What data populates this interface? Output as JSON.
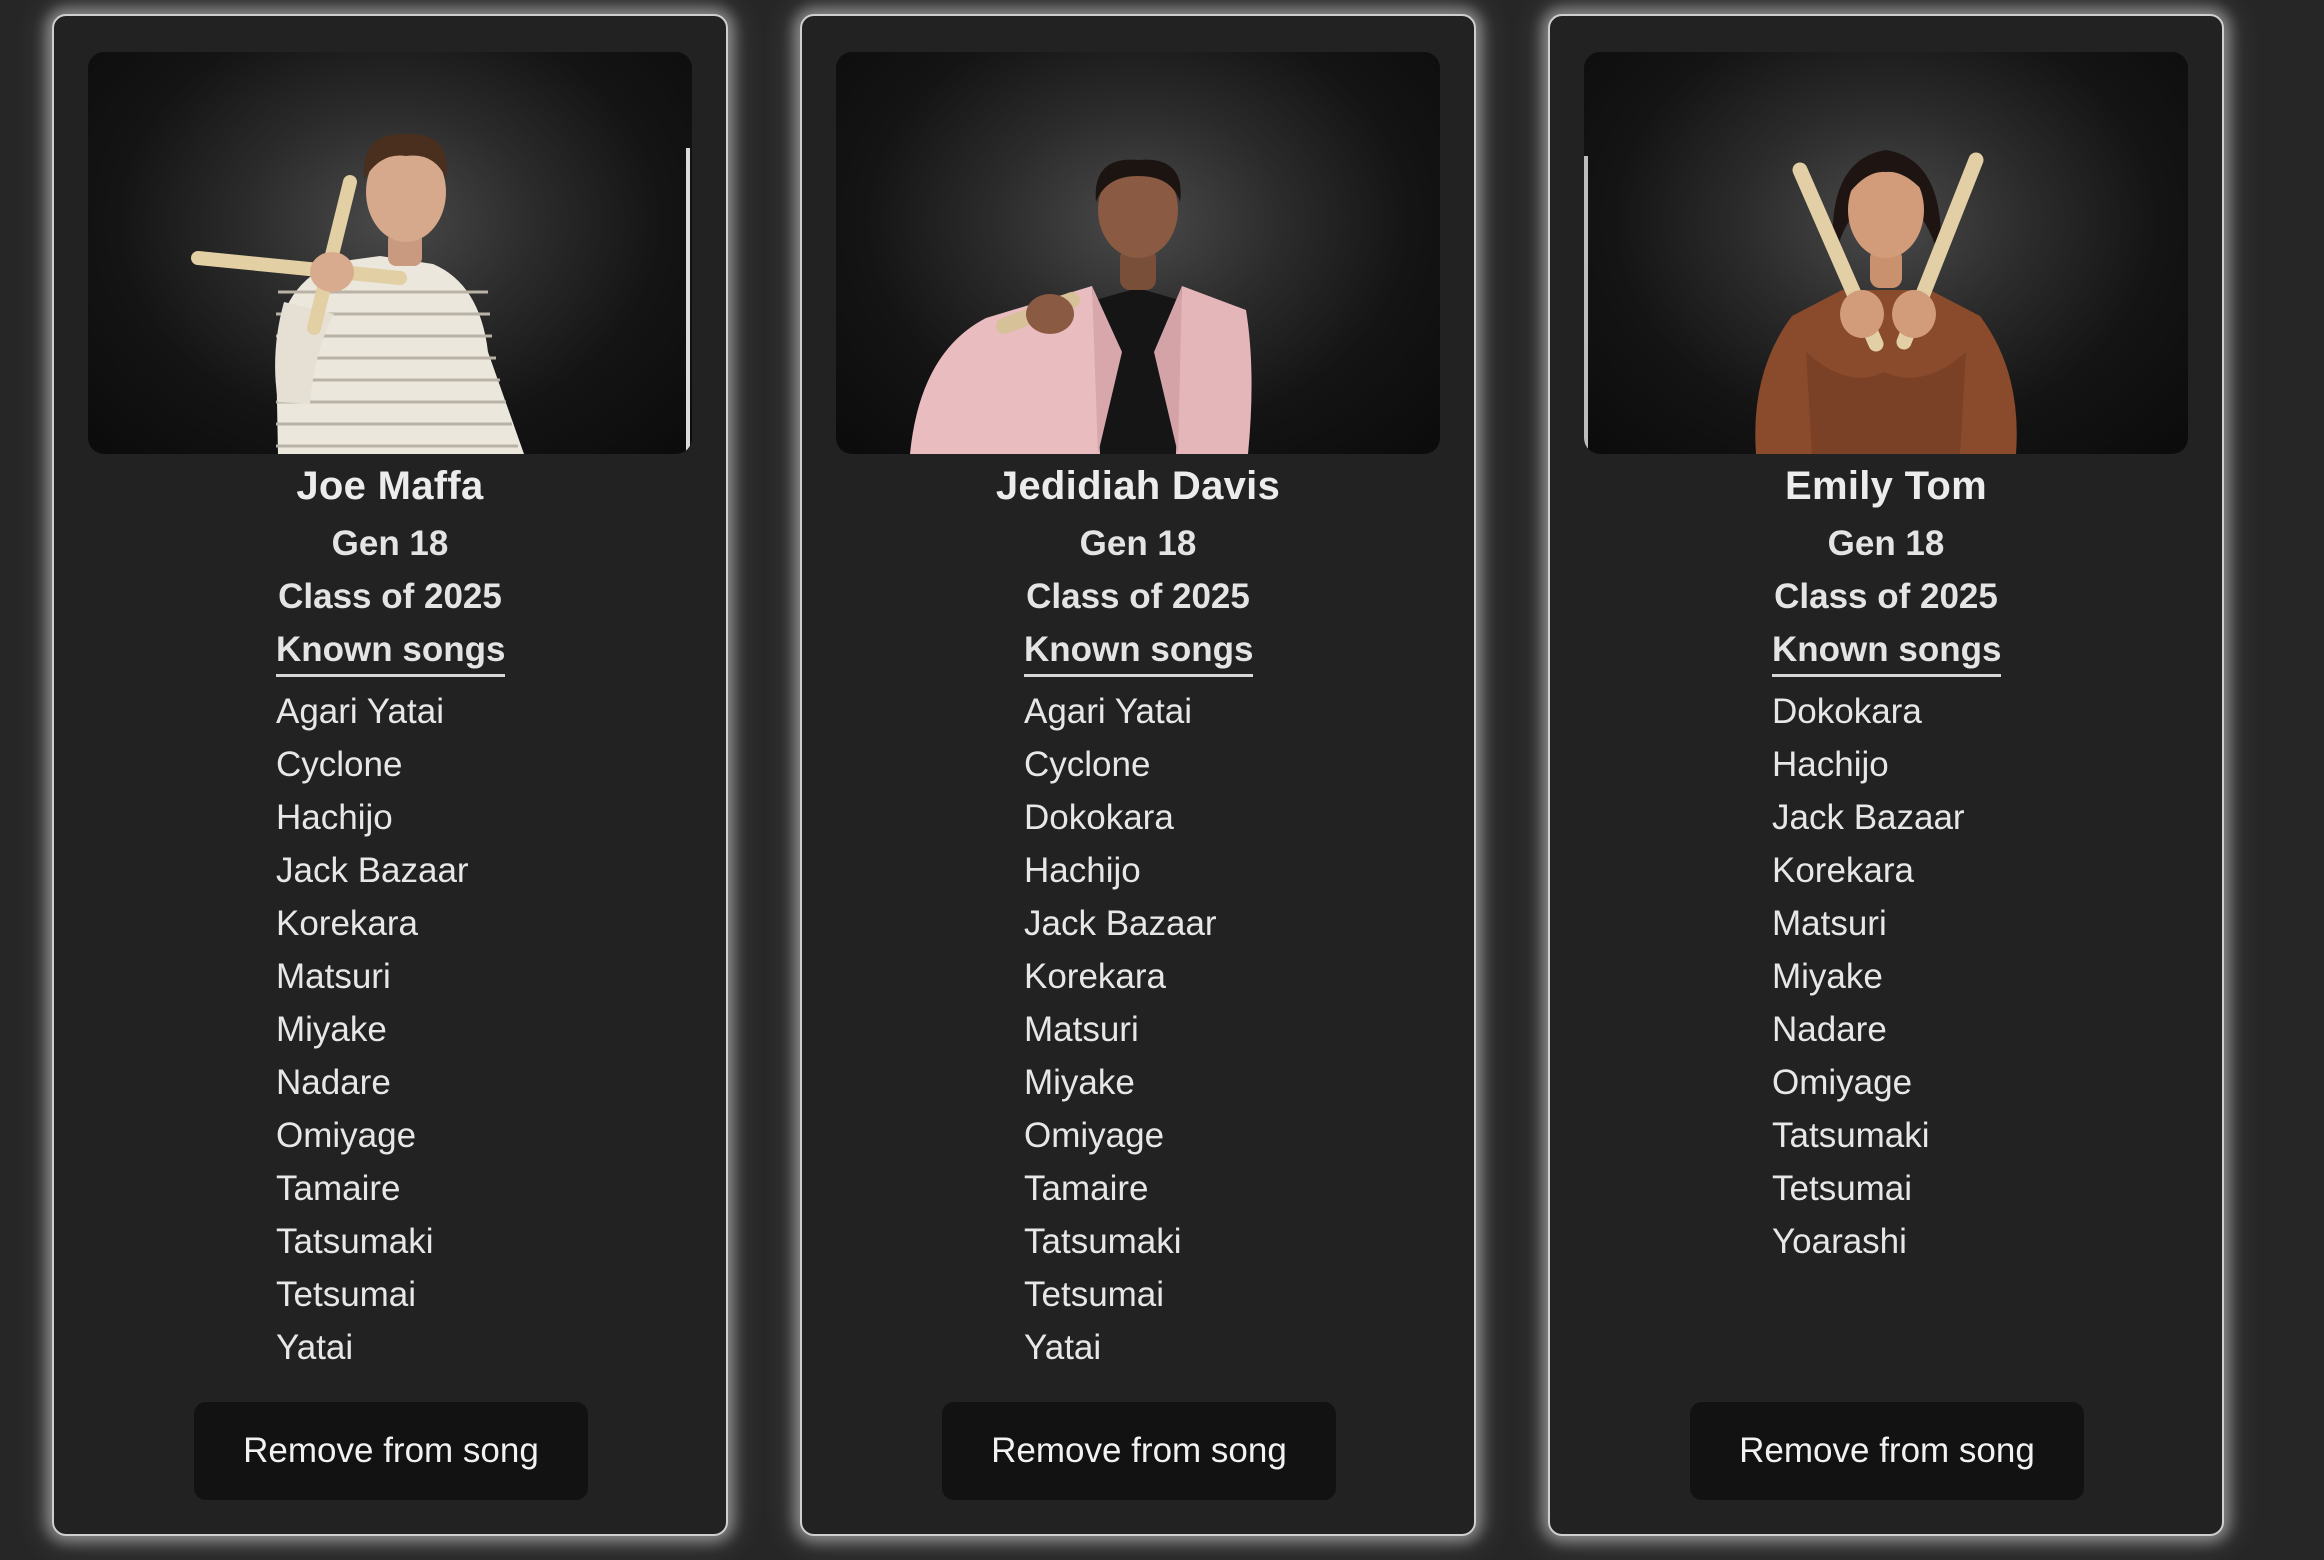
{
  "members": [
    {
      "name": "Joe Maffa",
      "gen": "Gen 18",
      "class": "Class of 2025",
      "songs_title": "Known songs",
      "songs": [
        "Agari Yatai",
        "Cyclone",
        "Hachijo",
        "Jack Bazaar",
        "Korekara",
        "Matsuri",
        "Miyake",
        "Nadare",
        "Omiyage",
        "Tamaire",
        "Tatsumaki",
        "Tetsumai",
        "Yatai"
      ],
      "button_label": "Remove from song"
    },
    {
      "name": "Jedidiah Davis",
      "gen": "Gen 18",
      "class": "Class of 2025",
      "songs_title": "Known songs",
      "songs": [
        "Agari Yatai",
        "Cyclone",
        "Dokokara",
        "Hachijo",
        "Jack Bazaar",
        "Korekara",
        "Matsuri",
        "Miyake",
        "Omiyage",
        "Tamaire",
        "Tatsumaki",
        "Tetsumai",
        "Yatai"
      ],
      "button_label": "Remove from song"
    },
    {
      "name": "Emily Tom",
      "gen": "Gen 18",
      "class": "Class of 2025",
      "songs_title": "Known songs",
      "songs": [
        "Dokokara",
        "Hachijo",
        "Jack Bazaar",
        "Korekara",
        "Matsuri",
        "Miyake",
        "Nadare",
        "Omiyage",
        "Tatsumaki",
        "Tetsumai",
        "Yoarashi"
      ],
      "button_label": "Remove from song"
    }
  ]
}
